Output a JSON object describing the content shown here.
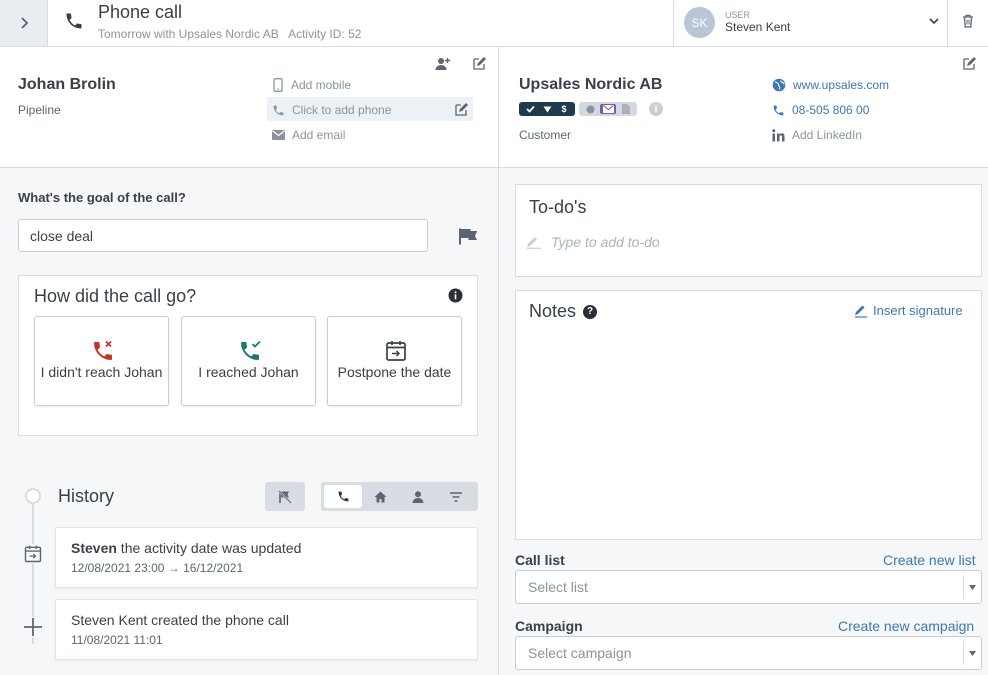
{
  "header": {
    "title": "Phone call",
    "subtitle": "Tomorrow with Upsales Nordic AB   Activity ID: 52",
    "user_label": "USER",
    "user_name": "Steven Kent",
    "user_initials": "SK"
  },
  "contact": {
    "name": "Johan Brolin",
    "subtitle": "Pipeline",
    "add_mobile": "Add mobile",
    "add_phone": "Click to add phone",
    "add_email": "Add email"
  },
  "company": {
    "name": "Upsales Nordic AB",
    "subtitle": "Customer",
    "website": "www.upsales.com",
    "phone": "08-505 806 00",
    "linkedin": "Add LinkedIn",
    "badge_dollar": "$",
    "info_glyph": "i"
  },
  "goal": {
    "label": "What's the goal of the call?",
    "value": "close deal"
  },
  "call_outcome": {
    "title": "How did the call go?",
    "options": [
      {
        "label": "I didn't reach Johan",
        "icon": "phone-missed-icon",
        "color": "#c0392b"
      },
      {
        "label": "I reached Johan",
        "icon": "phone-check-icon",
        "color": "#1f7a6d"
      },
      {
        "label": "Postpone the date",
        "icon": "calendar-forward-icon",
        "color": "#3a404a"
      }
    ]
  },
  "history": {
    "title": "History",
    "items": [
      {
        "actor": "Steven",
        "text": " the activity date was updated",
        "date": "12/08/2021 23:00 → 16/12/2021",
        "icon": "calendar-forward-icon"
      },
      {
        "actor": "",
        "text": "Steven Kent created the phone call",
        "date": "11/08/2021 11:01",
        "icon": "plus-icon"
      }
    ]
  },
  "todos": {
    "title": "To-do's",
    "placeholder": "Type to add to-do"
  },
  "notes": {
    "title": "Notes",
    "help_glyph": "?",
    "insert_signature": "Insert signature"
  },
  "call_list": {
    "label": "Call list",
    "create_link": "Create new list",
    "placeholder": "Select list"
  },
  "campaign": {
    "label": "Campaign",
    "create_link": "Create new campaign",
    "placeholder": "Select campaign"
  },
  "colors": {
    "accent_blue": "#3e78b0",
    "badge_dark": "#1f3a4c",
    "badge_mail": "#7b57a5"
  }
}
